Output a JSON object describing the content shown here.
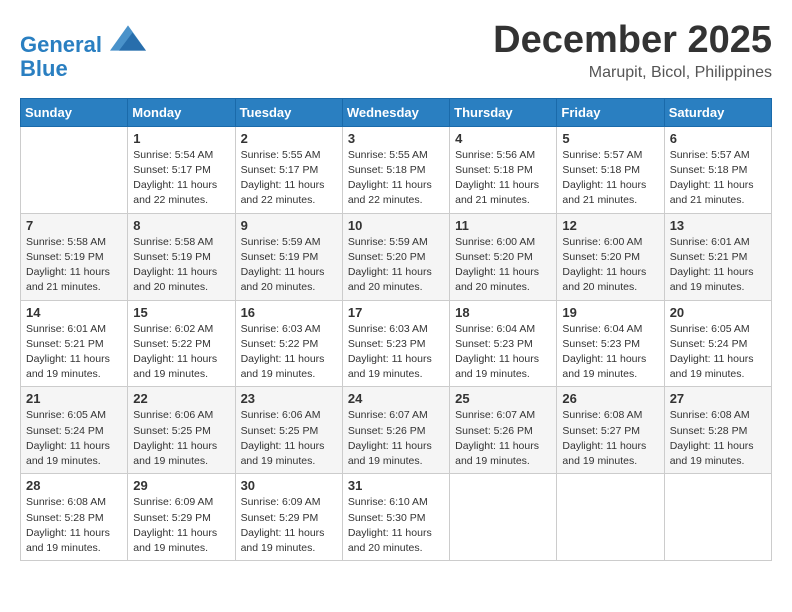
{
  "logo": {
    "line1": "General",
    "line2": "Blue"
  },
  "title": {
    "month": "December 2025",
    "location": "Marupit, Bicol, Philippines"
  },
  "weekdays": [
    "Sunday",
    "Monday",
    "Tuesday",
    "Wednesday",
    "Thursday",
    "Friday",
    "Saturday"
  ],
  "weeks": [
    [
      {
        "day": "",
        "info": ""
      },
      {
        "day": "1",
        "info": "Sunrise: 5:54 AM\nSunset: 5:17 PM\nDaylight: 11 hours\nand 22 minutes."
      },
      {
        "day": "2",
        "info": "Sunrise: 5:55 AM\nSunset: 5:17 PM\nDaylight: 11 hours\nand 22 minutes."
      },
      {
        "day": "3",
        "info": "Sunrise: 5:55 AM\nSunset: 5:18 PM\nDaylight: 11 hours\nand 22 minutes."
      },
      {
        "day": "4",
        "info": "Sunrise: 5:56 AM\nSunset: 5:18 PM\nDaylight: 11 hours\nand 21 minutes."
      },
      {
        "day": "5",
        "info": "Sunrise: 5:57 AM\nSunset: 5:18 PM\nDaylight: 11 hours\nand 21 minutes."
      },
      {
        "day": "6",
        "info": "Sunrise: 5:57 AM\nSunset: 5:18 PM\nDaylight: 11 hours\nand 21 minutes."
      }
    ],
    [
      {
        "day": "7",
        "info": "Sunrise: 5:58 AM\nSunset: 5:19 PM\nDaylight: 11 hours\nand 21 minutes."
      },
      {
        "day": "8",
        "info": "Sunrise: 5:58 AM\nSunset: 5:19 PM\nDaylight: 11 hours\nand 20 minutes."
      },
      {
        "day": "9",
        "info": "Sunrise: 5:59 AM\nSunset: 5:19 PM\nDaylight: 11 hours\nand 20 minutes."
      },
      {
        "day": "10",
        "info": "Sunrise: 5:59 AM\nSunset: 5:20 PM\nDaylight: 11 hours\nand 20 minutes."
      },
      {
        "day": "11",
        "info": "Sunrise: 6:00 AM\nSunset: 5:20 PM\nDaylight: 11 hours\nand 20 minutes."
      },
      {
        "day": "12",
        "info": "Sunrise: 6:00 AM\nSunset: 5:20 PM\nDaylight: 11 hours\nand 20 minutes."
      },
      {
        "day": "13",
        "info": "Sunrise: 6:01 AM\nSunset: 5:21 PM\nDaylight: 11 hours\nand 19 minutes."
      }
    ],
    [
      {
        "day": "14",
        "info": "Sunrise: 6:01 AM\nSunset: 5:21 PM\nDaylight: 11 hours\nand 19 minutes."
      },
      {
        "day": "15",
        "info": "Sunrise: 6:02 AM\nSunset: 5:22 PM\nDaylight: 11 hours\nand 19 minutes."
      },
      {
        "day": "16",
        "info": "Sunrise: 6:03 AM\nSunset: 5:22 PM\nDaylight: 11 hours\nand 19 minutes."
      },
      {
        "day": "17",
        "info": "Sunrise: 6:03 AM\nSunset: 5:23 PM\nDaylight: 11 hours\nand 19 minutes."
      },
      {
        "day": "18",
        "info": "Sunrise: 6:04 AM\nSunset: 5:23 PM\nDaylight: 11 hours\nand 19 minutes."
      },
      {
        "day": "19",
        "info": "Sunrise: 6:04 AM\nSunset: 5:23 PM\nDaylight: 11 hours\nand 19 minutes."
      },
      {
        "day": "20",
        "info": "Sunrise: 6:05 AM\nSunset: 5:24 PM\nDaylight: 11 hours\nand 19 minutes."
      }
    ],
    [
      {
        "day": "21",
        "info": "Sunrise: 6:05 AM\nSunset: 5:24 PM\nDaylight: 11 hours\nand 19 minutes."
      },
      {
        "day": "22",
        "info": "Sunrise: 6:06 AM\nSunset: 5:25 PM\nDaylight: 11 hours\nand 19 minutes."
      },
      {
        "day": "23",
        "info": "Sunrise: 6:06 AM\nSunset: 5:25 PM\nDaylight: 11 hours\nand 19 minutes."
      },
      {
        "day": "24",
        "info": "Sunrise: 6:07 AM\nSunset: 5:26 PM\nDaylight: 11 hours\nand 19 minutes."
      },
      {
        "day": "25",
        "info": "Sunrise: 6:07 AM\nSunset: 5:26 PM\nDaylight: 11 hours\nand 19 minutes."
      },
      {
        "day": "26",
        "info": "Sunrise: 6:08 AM\nSunset: 5:27 PM\nDaylight: 11 hours\nand 19 minutes."
      },
      {
        "day": "27",
        "info": "Sunrise: 6:08 AM\nSunset: 5:28 PM\nDaylight: 11 hours\nand 19 minutes."
      }
    ],
    [
      {
        "day": "28",
        "info": "Sunrise: 6:08 AM\nSunset: 5:28 PM\nDaylight: 11 hours\nand 19 minutes."
      },
      {
        "day": "29",
        "info": "Sunrise: 6:09 AM\nSunset: 5:29 PM\nDaylight: 11 hours\nand 19 minutes."
      },
      {
        "day": "30",
        "info": "Sunrise: 6:09 AM\nSunset: 5:29 PM\nDaylight: 11 hours\nand 19 minutes."
      },
      {
        "day": "31",
        "info": "Sunrise: 6:10 AM\nSunset: 5:30 PM\nDaylight: 11 hours\nand 20 minutes."
      },
      {
        "day": "",
        "info": ""
      },
      {
        "day": "",
        "info": ""
      },
      {
        "day": "",
        "info": ""
      }
    ]
  ]
}
